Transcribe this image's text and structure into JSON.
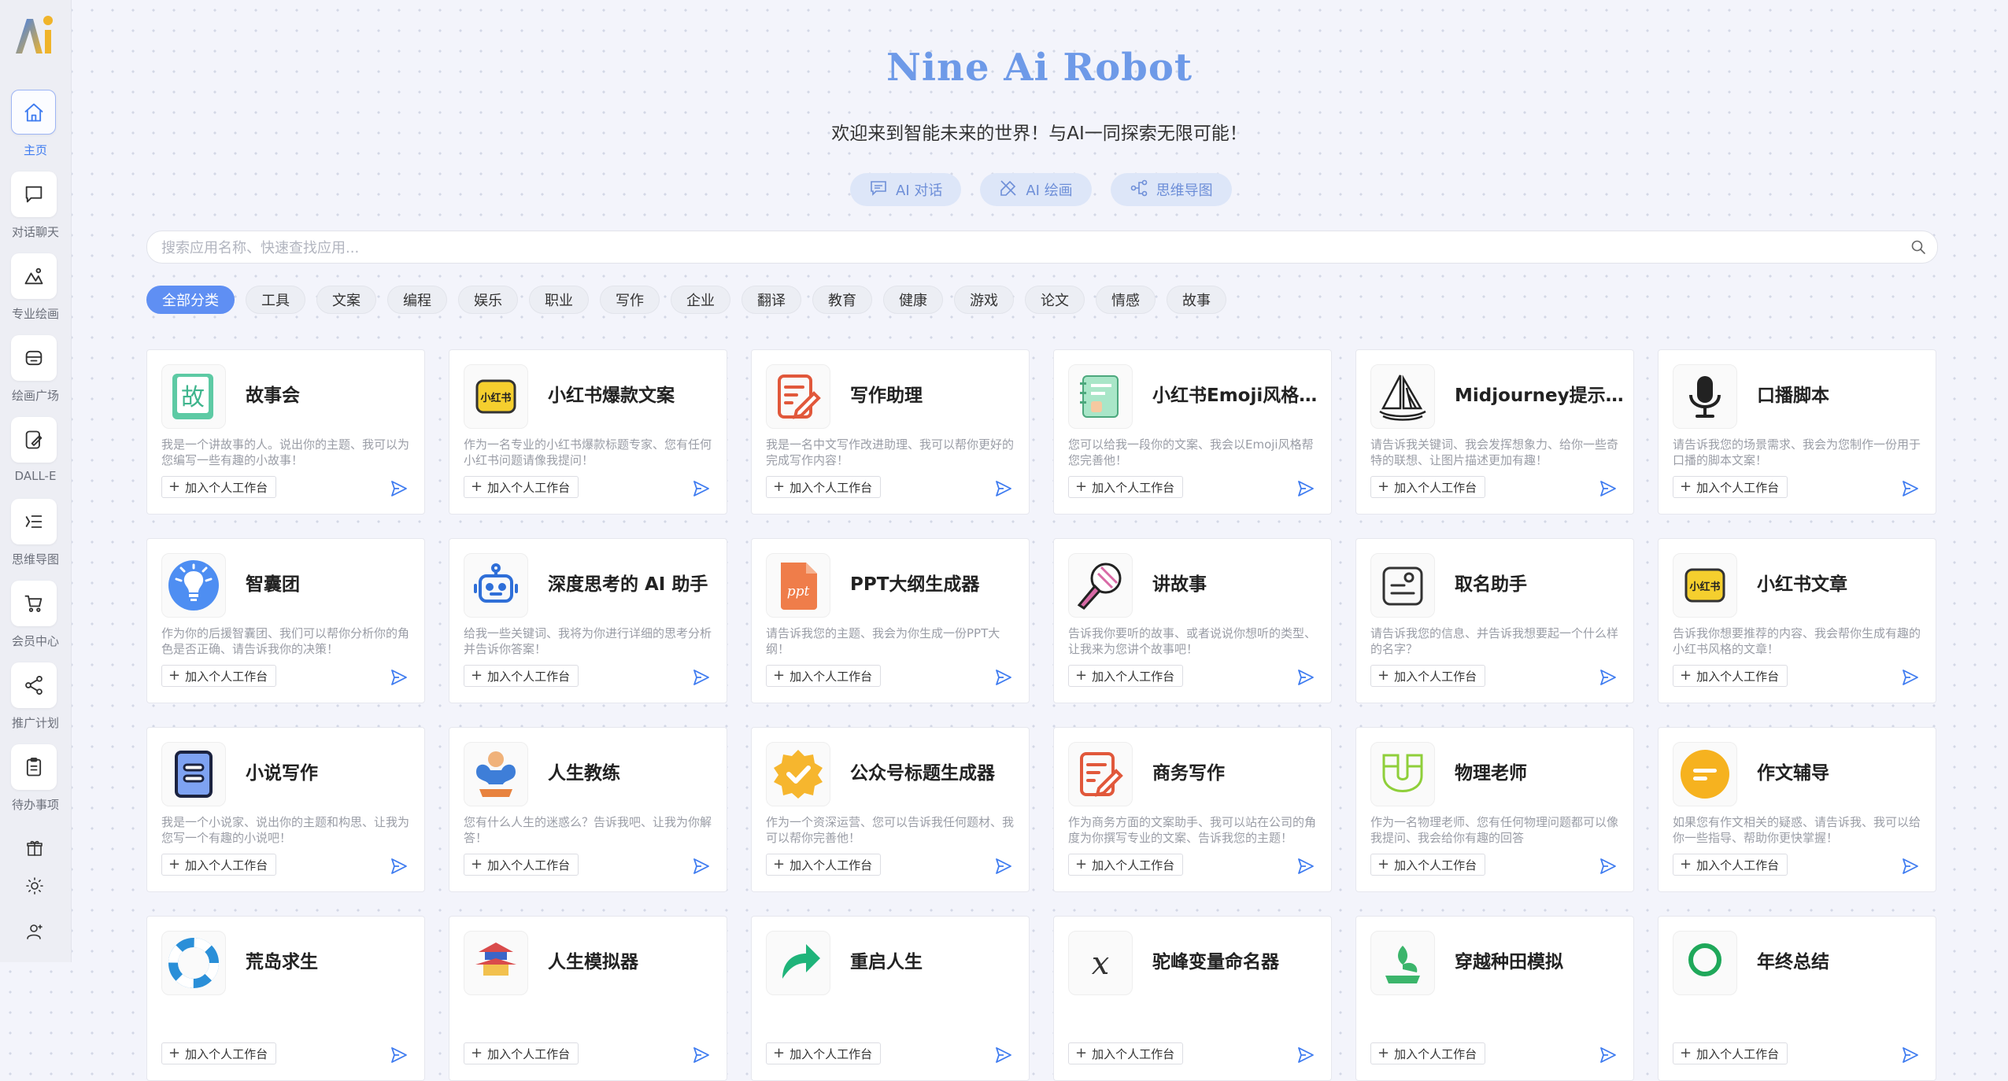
{
  "sidebar": {
    "items": [
      {
        "label": "主页",
        "icon": "home-icon",
        "active": true
      },
      {
        "label": "对话聊天",
        "icon": "chat-icon"
      },
      {
        "label": "专业绘画",
        "icon": "drawing-icon"
      },
      {
        "label": "绘画广场",
        "icon": "gallery-icon"
      },
      {
        "label": "DALL-E",
        "icon": "dalle-icon"
      },
      {
        "label": "思维导图",
        "icon": "mindmap-icon"
      },
      {
        "label": "会员中心",
        "icon": "cart-icon"
      },
      {
        "label": "推广计划",
        "icon": "share-icon"
      },
      {
        "label": "待办事项",
        "icon": "clipboard-icon"
      }
    ],
    "bottom": [
      "gift-icon",
      "sun-icon",
      "user-icon"
    ]
  },
  "header": {
    "title": "Nine Ai Robot",
    "subtitle": "欢迎来到智能未来的世界！与AI一同探索无限可能！"
  },
  "quick_actions": [
    {
      "label": "AI 对话",
      "icon": "chat-icon"
    },
    {
      "label": "AI 绘画",
      "icon": "paint-icon"
    },
    {
      "label": "思维导图",
      "icon": "mindmap-icon"
    }
  ],
  "search": {
    "placeholder": "搜索应用名称、快速查找应用...",
    "value": ""
  },
  "categories": [
    "全部分类",
    "工具",
    "文案",
    "编程",
    "娱乐",
    "职业",
    "写作",
    "企业",
    "翻译",
    "教育",
    "健康",
    "游戏",
    "论文",
    "情感",
    "故事"
  ],
  "active_category": "全部分类",
  "add_label": "加入个人工作台",
  "cards": [
    {
      "title": "故事会",
      "desc": "我是一个讲故事的人。说出你的主题、我可以为您编写一些有趣的小故事！",
      "icon": "book-story-icon"
    },
    {
      "title": "小红书爆款文案",
      "desc": "作为一名专业的小红书爆款标题专家、您有任何小红书问题请像我提问！",
      "icon": "xiaohongshu-icon"
    },
    {
      "title": "写作助理",
      "desc": "我是一名中文写作改进助理、我可以帮你更好的完成写作内容！",
      "icon": "edit-doc-icon"
    },
    {
      "title": "小红书Emoji风格文案",
      "desc": "您可以给我一段你的文案、我会以Emoji风格帮您完善他！",
      "icon": "notebook-icon"
    },
    {
      "title": "Midjourney提示词生成器",
      "desc": "请告诉我关键词、我会发挥想象力、给你一些奇特的联想、让图片描述更加有趣！",
      "icon": "sailboat-icon"
    },
    {
      "title": "口播脚本",
      "desc": "请告诉我您的场景需求、我会为您制作一份用于口播的脚本文案！",
      "icon": "microphone-icon"
    },
    {
      "title": "智囊团",
      "desc": "作为你的后援智囊团、我们可以帮你分析你的角色是否正确、请告诉我你的决策！",
      "icon": "lightbulb-icon"
    },
    {
      "title": "深度思考的 AI 助手",
      "desc": "给我一些关键词、我将为你进行详细的思考分析并告诉你答案！",
      "icon": "robot-icon"
    },
    {
      "title": "PPT大纲生成器",
      "desc": "请告诉我您的主题、我会为你生成一份PPT大纲！",
      "icon": "ppt-icon"
    },
    {
      "title": "讲故事",
      "desc": "告诉我你要听的故事、或者说说你想听的类型、让我来为您讲个故事吧！",
      "icon": "mic-story-icon"
    },
    {
      "title": "取名助手",
      "desc": "请告诉我您的信息、并告诉我想要起一个什么样的名字？",
      "icon": "name-card-icon"
    },
    {
      "title": "小红书文章",
      "desc": "告诉我你想要推荐的内容、我会帮你生成有趣的小红书风格的文章！",
      "icon": "xiaohongshu-icon"
    },
    {
      "title": "小说写作",
      "desc": "我是一个小说家、说出你的主题和构思、让我为您写一个有趣的小说吧！",
      "icon": "novel-icon"
    },
    {
      "title": "人生教练",
      "desc": "您有什么人生的迷惑么？告诉我吧、让我为你解答！",
      "icon": "muscle-icon"
    },
    {
      "title": "公众号标题生成器",
      "desc": "作为一个资深运营、您可以告诉我任何题材、我可以帮你完善他！",
      "icon": "check-badge-icon"
    },
    {
      "title": "商务写作",
      "desc": "作为商务方面的文案助手、我可以站在公司的角度为你撰写专业的文案、告诉我您的主题！",
      "icon": "edit-doc-icon"
    },
    {
      "title": "物理老师",
      "desc": "作为一名物理老师、您有任何物理问题都可以像我提问、我会给你有趣的回答",
      "icon": "magnet-icon"
    },
    {
      "title": "作文辅导",
      "desc": "如果您有作文相关的疑惑、请告诉我、我可以给你一些指导、帮助你更快掌握！",
      "icon": "essay-icon"
    },
    {
      "title": "荒岛求生",
      "desc": "",
      "icon": "lifebuoy-icon"
    },
    {
      "title": "人生模拟器",
      "desc": "",
      "icon": "pagoda-icon"
    },
    {
      "title": "重启人生",
      "desc": "",
      "icon": "restart-icon"
    },
    {
      "title": "驼峰变量命名器",
      "desc": "",
      "icon": "variable-icon"
    },
    {
      "title": "穿越种田模拟",
      "desc": "",
      "icon": "farm-icon"
    },
    {
      "title": "年终总结",
      "desc": "",
      "icon": "summary-icon"
    }
  ],
  "colors": {
    "accent": "#5f8ff3",
    "title": "#6e9ae8",
    "background": "#f3f4fb"
  }
}
